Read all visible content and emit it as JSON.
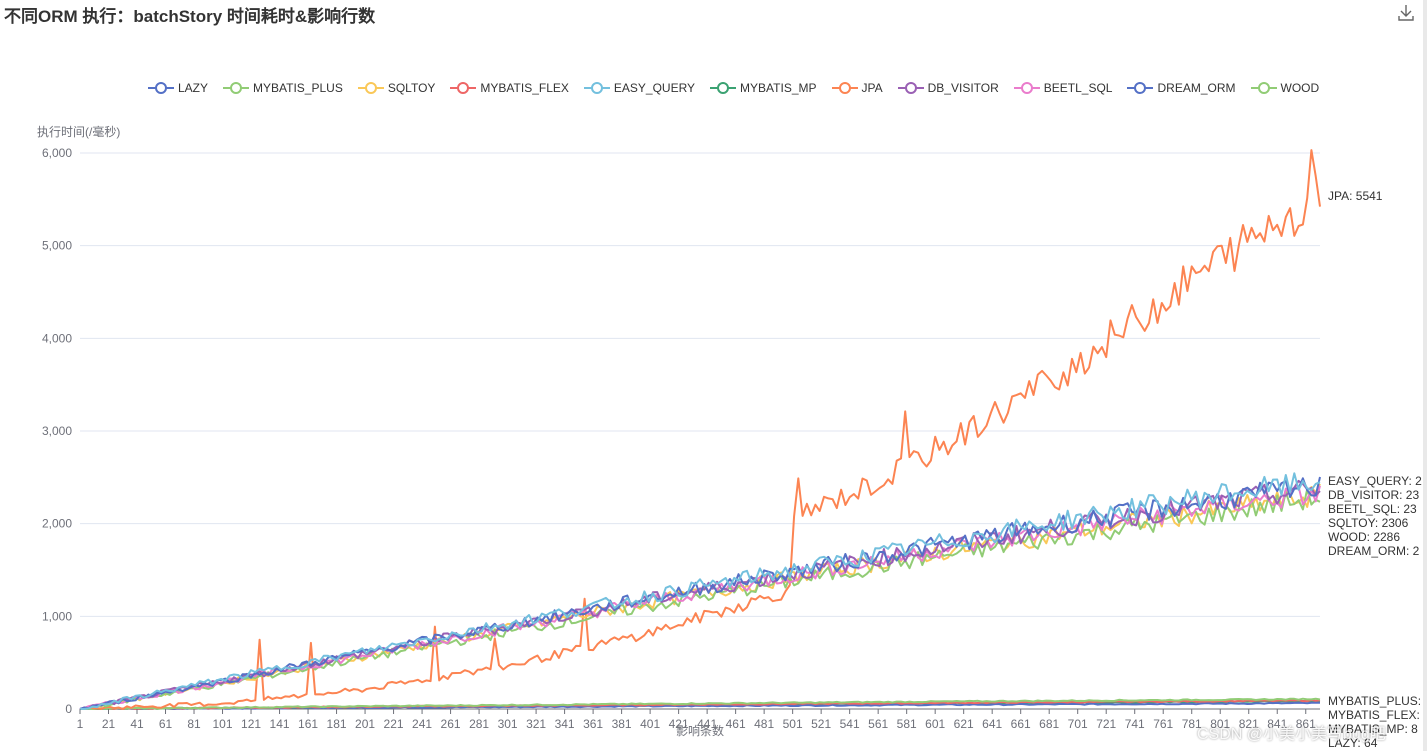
{
  "title": "不同ORM 执行：batchStory 时间耗时&影响行数",
  "toolbar": {
    "download_icon": "download-icon"
  },
  "watermark": "CSDN @小美小美写bug吧",
  "chart_data": {
    "type": "line",
    "title": "不同ORM 执行：batchStory 时间耗时&影响行数",
    "xlabel": "影响条数",
    "ylabel": "执行时间(/毫秒)",
    "xlim": [
      1,
      871
    ],
    "ylim": [
      0,
      6000
    ],
    "y_ticks": [
      0,
      1000,
      2000,
      3000,
      4000,
      5000,
      6000
    ],
    "y_tick_labels": [
      "0",
      "1,000",
      "2,000",
      "3,000",
      "4,000",
      "5,000",
      "6,000"
    ],
    "x_tick_labels": [
      "1",
      "21",
      "41",
      "61",
      "81",
      "101",
      "121",
      "141",
      "161",
      "181",
      "201",
      "221",
      "241",
      "261",
      "281",
      "301",
      "321",
      "341",
      "361",
      "381",
      "401",
      "421",
      "441",
      "461",
      "481",
      "501",
      "521",
      "541",
      "561",
      "581",
      "601",
      "621",
      "641",
      "661",
      "681",
      "701",
      "721",
      "741",
      "761",
      "781",
      "801",
      "821",
      "841",
      "861"
    ],
    "grid": true,
    "legend_position": "top-center",
    "series": [
      {
        "name": "LAZY",
        "color": "#5470c6",
        "end_label": "LAZY: 64",
        "x": [
          1,
          200,
          400,
          600,
          800,
          871
        ],
        "y": [
          0,
          15,
          30,
          45,
          58,
          64
        ]
      },
      {
        "name": "MYBATIS_PLUS",
        "color": "#91cc75",
        "end_label": "MYBATIS_PLUS: ",
        "x": [
          1,
          200,
          400,
          600,
          800,
          871
        ],
        "y": [
          0,
          30,
          55,
          80,
          100,
          108
        ]
      },
      {
        "name": "SQLTOY",
        "color": "#fac858",
        "end_label": "SQLTOY: 2306",
        "x": [
          1,
          100,
          200,
          300,
          400,
          500,
          600,
          700,
          800,
          871
        ],
        "y": [
          0,
          280,
          570,
          860,
          1150,
          1420,
          1680,
          1920,
          2150,
          2306
        ]
      },
      {
        "name": "MYBATIS_FLEX",
        "color": "#ee6666",
        "end_label": "MYBATIS_FLEX: ",
        "x": [
          1,
          200,
          400,
          600,
          800,
          871
        ],
        "y": [
          0,
          25,
          45,
          65,
          85,
          92
        ]
      },
      {
        "name": "EASY_QUERY",
        "color": "#73c0de",
        "end_label": "EASY_QUERY: 2",
        "x": [
          1,
          100,
          200,
          300,
          400,
          500,
          600,
          700,
          800,
          871
        ],
        "y": [
          0,
          320,
          620,
          920,
          1220,
          1500,
          1780,
          2060,
          2320,
          2450
        ]
      },
      {
        "name": "MYBATIS_MP",
        "color": "#3ba272",
        "end_label": "MYBATIS_MP: 8",
        "x": [
          1,
          200,
          400,
          600,
          800,
          871
        ],
        "y": [
          0,
          20,
          40,
          60,
          78,
          85
        ]
      },
      {
        "name": "JPA",
        "color": "#fc8452",
        "end_label": "JPA: 5541",
        "x": [
          1,
          100,
          200,
          300,
          400,
          499,
          501,
          560,
          620,
          700,
          800,
          871
        ],
        "y": [
          0,
          60,
          210,
          460,
          820,
          1280,
          2060,
          2440,
          2960,
          3730,
          4850,
          5541
        ]
      },
      {
        "name": "DB_VISITOR",
        "color": "#9a60b4",
        "end_label": "DB_VISITOR: 23",
        "x": [
          1,
          100,
          200,
          300,
          400,
          500,
          600,
          700,
          800,
          871
        ],
        "y": [
          0,
          300,
          600,
          890,
          1180,
          1460,
          1730,
          1990,
          2230,
          2380
        ]
      },
      {
        "name": "BEETL_SQL",
        "color": "#ea7ccc",
        "end_label": "BEETL_SQL: 23",
        "x": [
          1,
          100,
          200,
          300,
          400,
          500,
          600,
          700,
          800,
          871
        ],
        "y": [
          0,
          290,
          580,
          870,
          1160,
          1440,
          1710,
          1960,
          2200,
          2320
        ]
      },
      {
        "name": "DREAM_ORM",
        "color": "#5470c6",
        "end_label": "DREAM_ORM: 2",
        "x": [
          1,
          100,
          200,
          300,
          400,
          500,
          600,
          700,
          800,
          871
        ],
        "y": [
          0,
          300,
          610,
          900,
          1200,
          1480,
          1760,
          2020,
          2260,
          2400
        ]
      },
      {
        "name": "WOOD",
        "color": "#91cc75",
        "end_label": "WOOD: 2286",
        "x": [
          1,
          100,
          200,
          300,
          400,
          500,
          600,
          700,
          800,
          871
        ],
        "y": [
          0,
          270,
          550,
          830,
          1110,
          1380,
          1640,
          1880,
          2110,
          2286
        ]
      }
    ]
  }
}
